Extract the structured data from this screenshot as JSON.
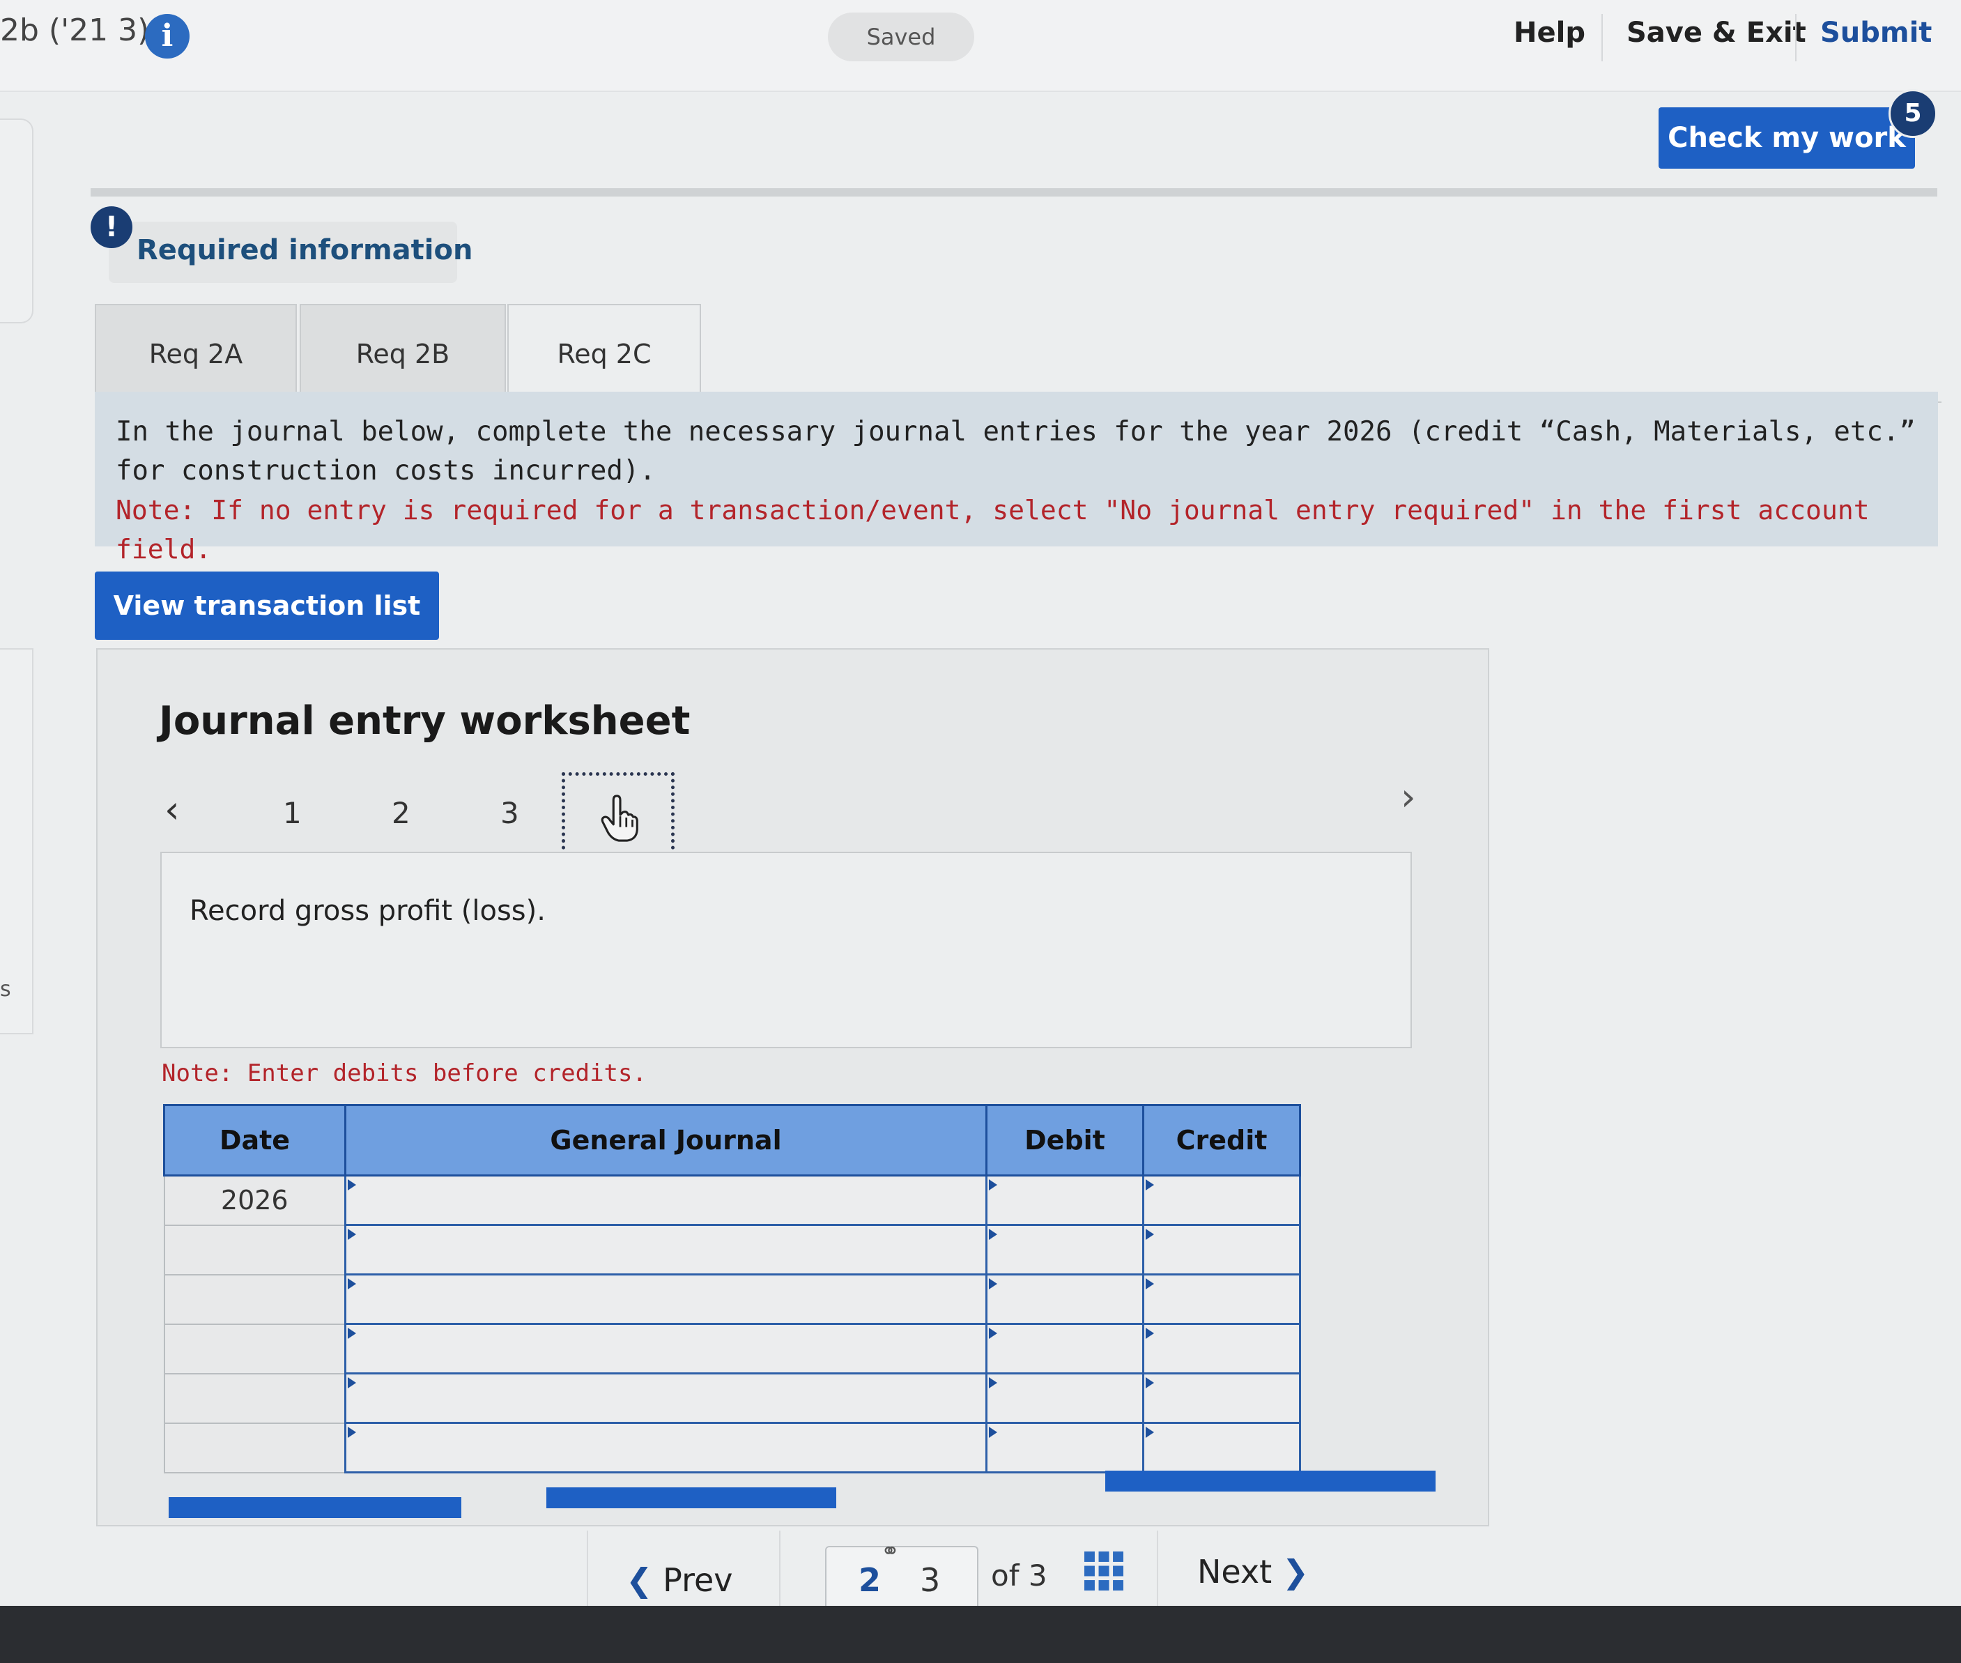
{
  "header": {
    "question_label": "2b ('21 3)",
    "info_icon": "info-icon",
    "saved_label": "Saved",
    "help_label": "Help",
    "save_exit_label": "Save & Exit",
    "submit_label": "Submit",
    "check_my_work_label": "Check my work",
    "check_badge_count": "5"
  },
  "required_info": {
    "alert_icon": "exclamation-icon",
    "alert_glyph": "!",
    "label": "Required information"
  },
  "tabs": [
    {
      "label": "Req 2A",
      "active": false
    },
    {
      "label": "Req 2B",
      "active": false
    },
    {
      "label": "Req 2C",
      "active": true
    }
  ],
  "instructions": {
    "text": "In the journal below, complete the necessary journal entries for the year 2026 (credit “Cash, Materials, etc.” for construction costs incurred).",
    "note": "Note: If no entry is required for a transaction/event, select \"No journal entry required\" in the first account field."
  },
  "view_transaction_list_label": "View transaction list",
  "worksheet": {
    "title": "Journal entry worksheet",
    "pages": [
      "1",
      "2",
      "3"
    ],
    "current_page_icon": "hand-cursor-icon",
    "description": "Record gross profit (loss).",
    "note": "Note: Enter debits before credits.",
    "columns": [
      "Date",
      "General Journal",
      "Debit",
      "Credit"
    ],
    "rows": [
      {
        "date": "2026",
        "account": "",
        "debit": "",
        "credit": ""
      },
      {
        "date": "",
        "account": "",
        "debit": "",
        "credit": ""
      },
      {
        "date": "",
        "account": "",
        "debit": "",
        "credit": ""
      },
      {
        "date": "",
        "account": "",
        "debit": "",
        "credit": ""
      },
      {
        "date": "",
        "account": "",
        "debit": "",
        "credit": ""
      },
      {
        "date": "",
        "account": "",
        "debit": "",
        "credit": ""
      }
    ]
  },
  "bottom_nav": {
    "prev_label": "Prev",
    "page_a": "2",
    "page_b": "3",
    "of_label": "of 3",
    "next_label": "Next",
    "link_icon": "link-icon",
    "grid_icon": "grid-icon"
  },
  "colors": {
    "accent_blue": "#1e60c4",
    "header_blue": "#6f9fe0",
    "note_red": "#b3242a",
    "badge_navy": "#1a3d73"
  }
}
